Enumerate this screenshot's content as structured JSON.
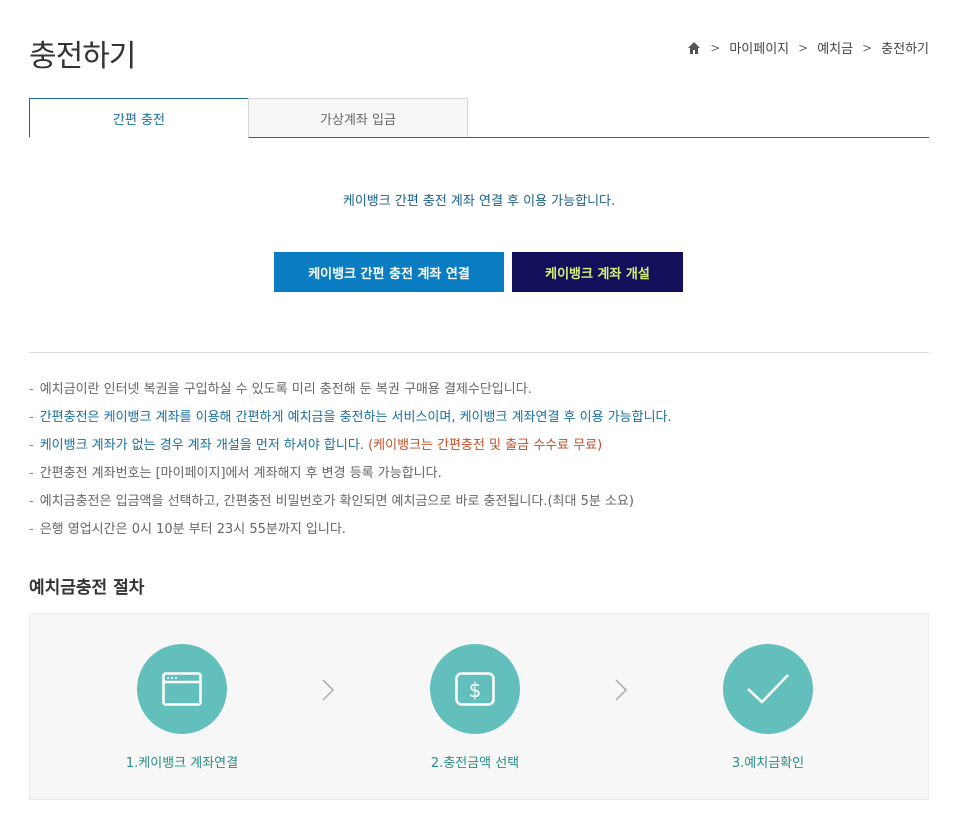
{
  "page": {
    "title": "충전하기"
  },
  "breadcrumb": {
    "items": [
      "마이페이지",
      "예치금",
      "충전하기"
    ],
    "home_icon": "home-icon"
  },
  "tabs": [
    {
      "label": "간편 충전",
      "active": true
    },
    {
      "label": "가상계좌 입금",
      "active": false
    }
  ],
  "notice": "케이뱅크 간편 충전 계좌 연결 후 이용 가능합니다.",
  "buttons": {
    "link_account": "케이뱅크 간편 충전 계좌 연결",
    "open_account": "케이뱅크 계좌 개설"
  },
  "info": [
    {
      "text": "예치금이란 인터넷 복권을 구입하실 수 있도록 미리 충전해 둔 복권 구매용 결제수단입니다."
    },
    {
      "text": "간편충전은 케이뱅크 계좌를 이용해 간편하게 예치금을 충전하는 서비스이며, 케이뱅크 계좌연결 후 이용 가능합니다."
    },
    {
      "text": "케이뱅크 계좌가 없는 경우 계좌 개설을 먼저 하셔야 합니다.",
      "highlight": "(케이뱅크는 간편충전 및 출금 수수료 무료)"
    },
    {
      "text": "간편충전 계좌번호는 [마이페이지]에서 계좌해지 후 변경 등록 가능합니다."
    },
    {
      "text": "예치금충전은 입금액을 선택하고, 간편충전 비밀번호가 확인되면 예치금으로 바로 충전됩니다.(최대 5분 소요)"
    },
    {
      "text": "은행 영업시간은 0시 10분 부터 23시 55분까지 입니다."
    }
  ],
  "process": {
    "title": "예치금충전 절차",
    "steps": [
      {
        "label": "1.케이뱅크 계좌연결",
        "icon": "browser-window-icon"
      },
      {
        "label": "2.충전금액 선택",
        "icon": "dollar-icon"
      },
      {
        "label": "3.예치금확인",
        "icon": "check-icon"
      }
    ]
  },
  "colors": {
    "accent_blue": "#0a7cc1",
    "dark_navy": "#12105a",
    "lime_text": "#d4f27a",
    "teal": "#62bfbc",
    "orange": "#c0502a"
  }
}
